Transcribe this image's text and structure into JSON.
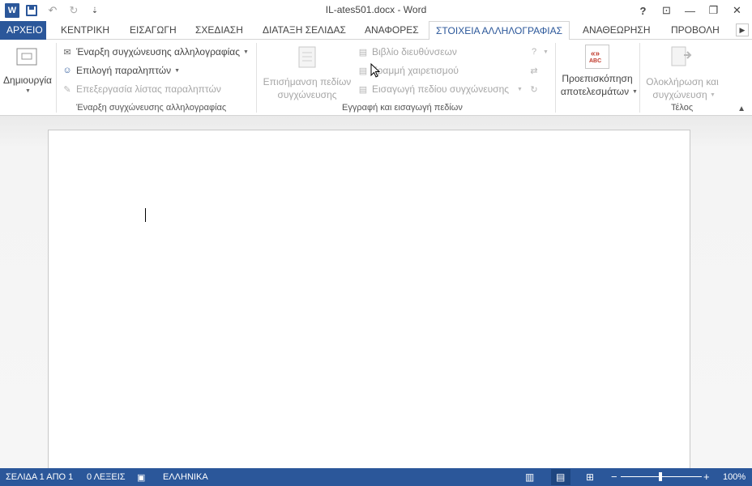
{
  "window": {
    "title": "IL-ates501.docx - Word",
    "controls": {
      "help": "?",
      "restore_ribbon": "⊡",
      "minimize": "—",
      "maximize": "❐",
      "close": "✕"
    }
  },
  "qat": {
    "undo": "↶",
    "redo": "↻",
    "customize": "⇣"
  },
  "tabs": [
    {
      "label": "ΑΡΧΕΙΟ"
    },
    {
      "label": "ΚΕΝΤΡΙΚΗ"
    },
    {
      "label": "ΕΙΣΑΓΩΓΗ"
    },
    {
      "label": "ΣΧΕΔΙΑΣΗ"
    },
    {
      "label": "ΔΙΑΤΑΞΗ ΣΕΛΙΔΑΣ"
    },
    {
      "label": "ΑΝΑΦΟΡΕΣ"
    },
    {
      "label": "ΣΤΟΙΧΕΙΑ ΑΛΛΗΛΟΓΡΑΦΙΑΣ"
    },
    {
      "label": "ΑΝΑΘΕΩΡΗΣΗ"
    },
    {
      "label": "ΠΡΟΒΟΛΗ"
    }
  ],
  "ribbon": {
    "create": {
      "label": "Δημιουργία"
    },
    "start_group": {
      "start_merge": "Έναρξη συγχώνευσης αλληλογραφίας",
      "select_recipients": "Επιλογή παραληπτών",
      "edit_list": "Επεξεργασία λίστας παραληπτών",
      "group_label": "Έναρξη συγχώνευσης αλληλογραφίας"
    },
    "write_group": {
      "highlight_fields_1": "Επισήμανση πεδίων",
      "highlight_fields_2": "συγχώνευσης",
      "address_block": "Βιβλίο διευθύνσεων",
      "greeting_line": "Γραμμή χαιρετισμού",
      "insert_field": "Εισαγωγή πεδίου συγχώνευσης",
      "group_label": "Εγγραφή και εισαγωγή πεδίων"
    },
    "preview": {
      "icon_text": "ABC",
      "label_1": "Προεπισκόπηση",
      "label_2": "αποτελεσμάτων"
    },
    "finish_group": {
      "label_1": "Ολοκλήρωση και",
      "label_2": "συγχώνευση",
      "group_label": "Τέλος"
    }
  },
  "status": {
    "page": "ΣΕΛΙΔΑ 1 ΑΠΟ 1",
    "words": "0 ΛΕΞΕΙΣ",
    "language": "ΕΛΛΗΝΙΚΑ",
    "zoom_minus": "−",
    "zoom_plus": "+",
    "zoom": "100%",
    "zoom_level": 100
  },
  "colors": {
    "accent": "#2b579a"
  }
}
